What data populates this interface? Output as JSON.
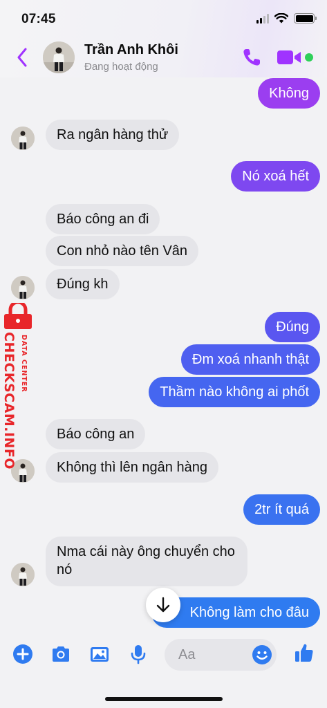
{
  "status_bar": {
    "time": "07:45"
  },
  "header": {
    "contact_name": "Trần Anh Khôi",
    "contact_status": "Đang hoạt động"
  },
  "messages": [
    {
      "side": "out",
      "text": "Không"
    },
    {
      "side": "in",
      "text": "Ra ngân hàng thử"
    },
    {
      "side": "out",
      "text": "Nó xoá hết"
    },
    {
      "side": "in",
      "text": "Báo công an đi"
    },
    {
      "side": "in",
      "text": "Con nhỏ nào tên Vân"
    },
    {
      "side": "in",
      "text": "Đúng kh"
    },
    {
      "side": "out",
      "text": "Đúng"
    },
    {
      "side": "out",
      "text": "Đm xoá nhanh thật"
    },
    {
      "side": "out",
      "text": "Thầm nào không ai phốt"
    },
    {
      "side": "in",
      "text": "Báo công an"
    },
    {
      "side": "in",
      "text": "Không thì lên ngân hàng"
    },
    {
      "side": "out",
      "text": "2tr ít quá"
    },
    {
      "side": "in",
      "text": "Nma cái này ông chuyển cho nó"
    },
    {
      "side": "out",
      "text": "Không làm cho đâu"
    }
  ],
  "watermark": {
    "main_text": "CHECKSCAM.INFO",
    "sub_text": "DATA CENTER"
  },
  "composer": {
    "placeholder": "Aa",
    "icons": [
      "plus-icon",
      "camera-icon",
      "image-icon",
      "microphone-icon",
      "emoji-icon",
      "thumbs-up-icon"
    ]
  },
  "colors": {
    "accent_purple": "#a033ff",
    "outgoing_top": "#9b3ef0",
    "outgoing_mid": "#5a56f0",
    "outgoing_bottom": "#2f7bf0",
    "incoming_bubble": "#e5e5e9",
    "composer_icons": "#2f7bf0",
    "watermark_red": "#e8262a",
    "online_green": "#2fd05a"
  }
}
